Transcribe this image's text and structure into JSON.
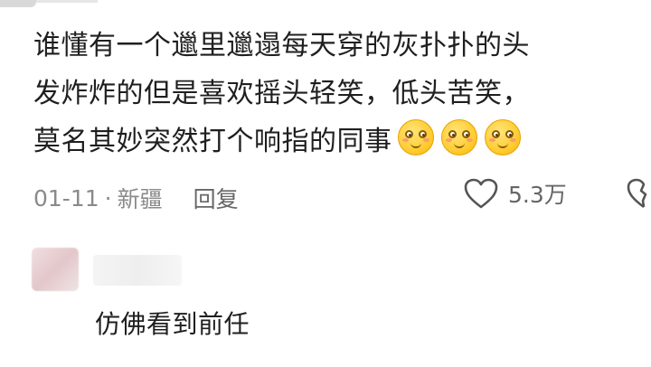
{
  "comment": {
    "text_lines": [
      "谁懂有一个邋里邋遢每天穿的灰扑扑的头",
      "发炸炸的但是喜欢摇头轻笑，低头苦笑，",
      "莫名其妙突然打个响指的同事"
    ],
    "emoji_count_label": "3",
    "date": "01-11",
    "separator": "·",
    "location": "新疆",
    "reply_label": "回复",
    "like_count": "5.3万"
  },
  "reply_comment": {
    "text": "仿佛看到前任"
  },
  "colors": {
    "text": "#1f1f1f",
    "meta": "#8a8a8a",
    "emoji": "#ffcc33"
  },
  "icons": [
    "heart-outline-icon",
    "heart-broken-icon",
    "smiley-emoji-icon"
  ]
}
